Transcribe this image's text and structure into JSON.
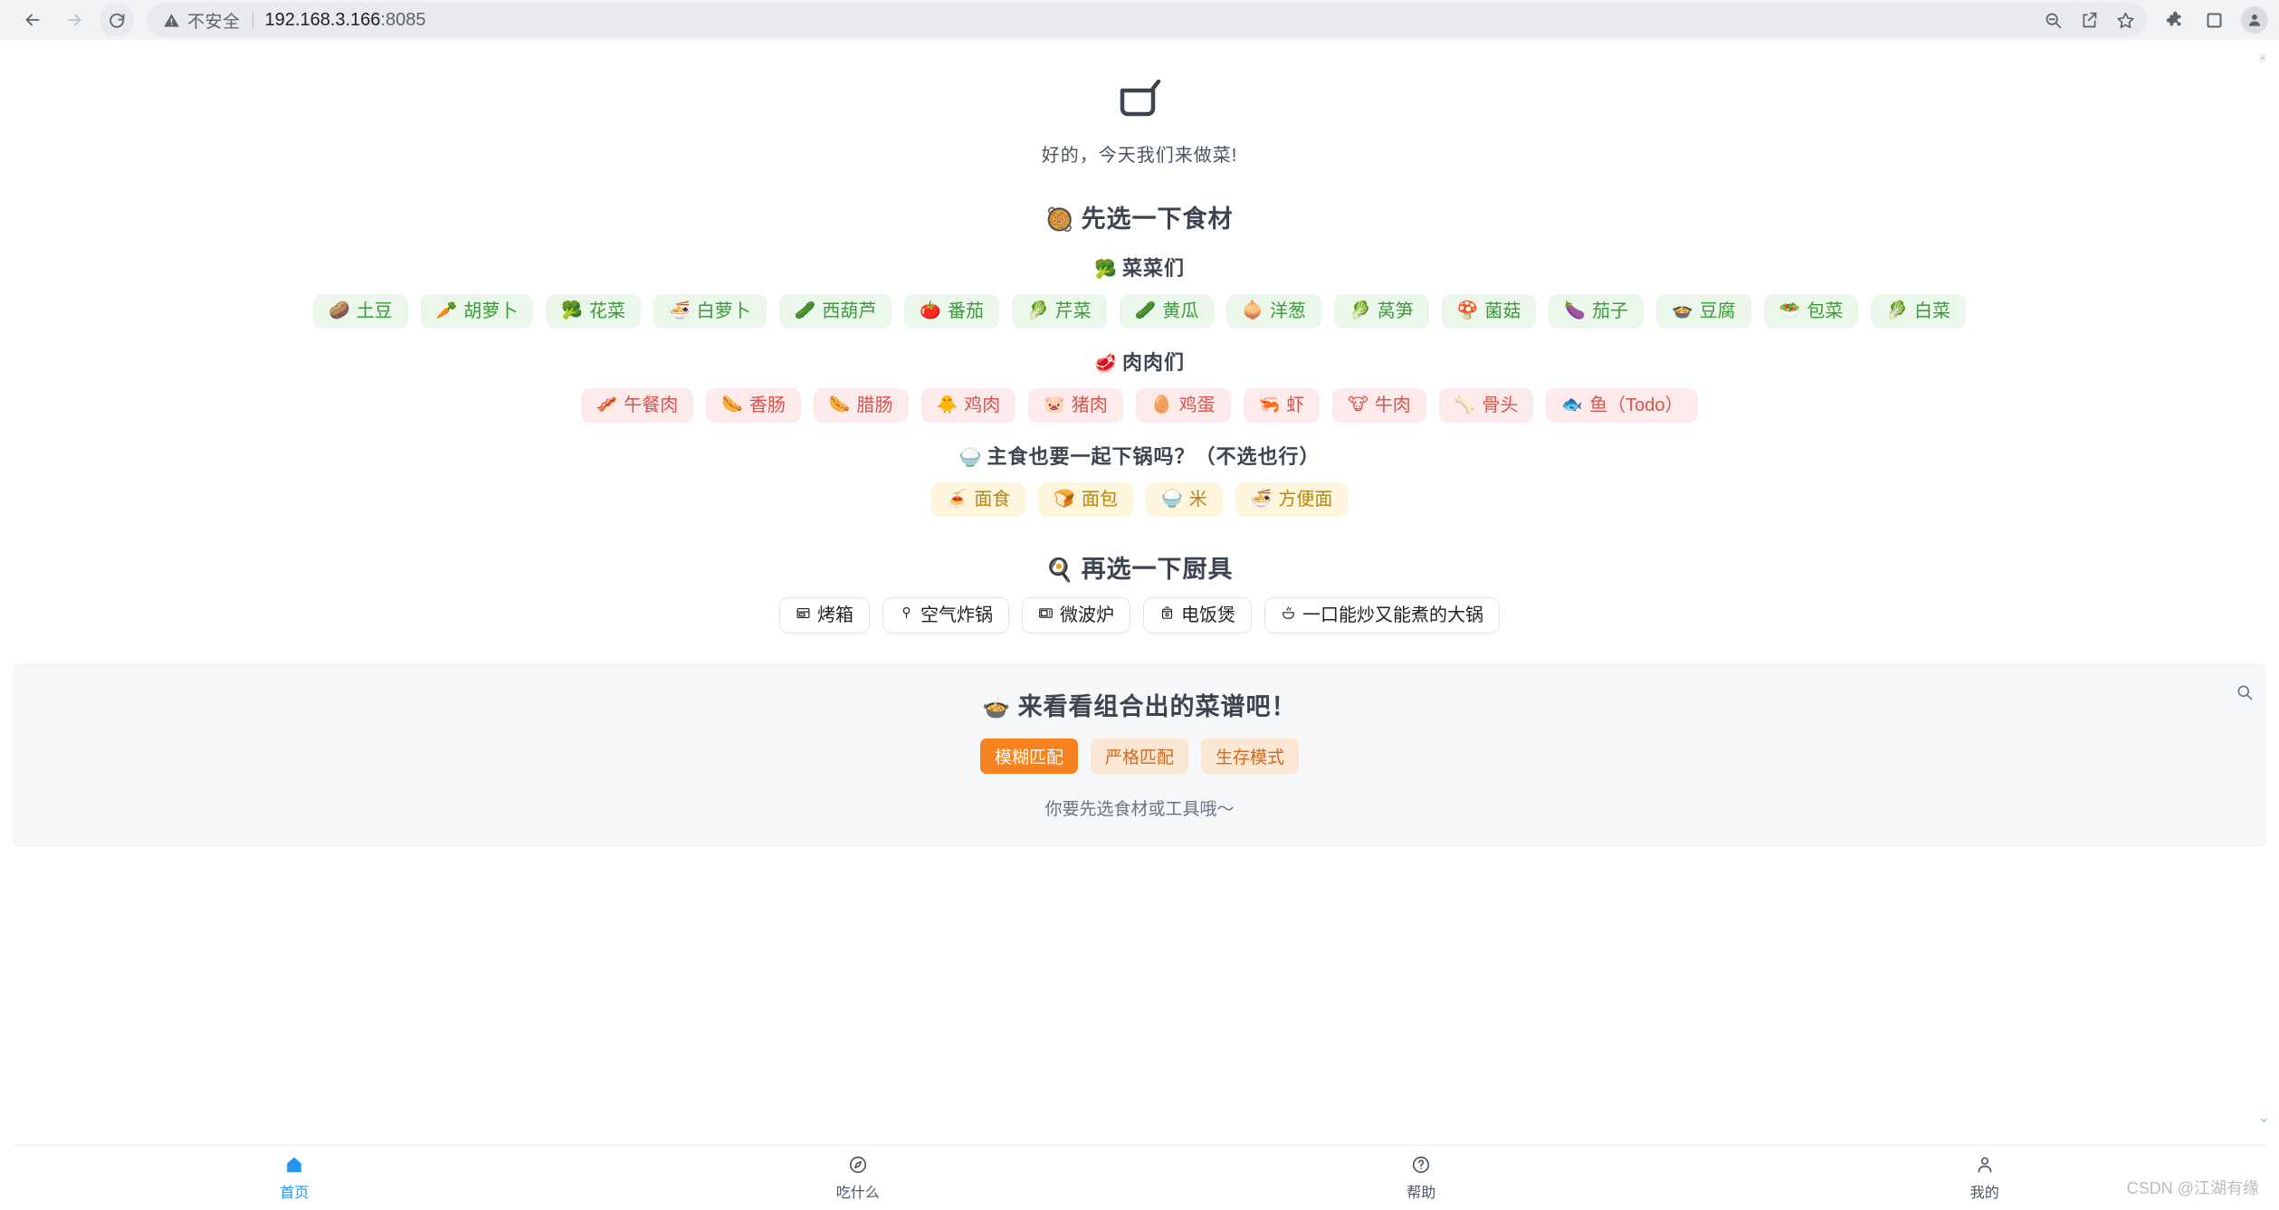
{
  "browser": {
    "back_icon": "back-arrow-icon",
    "forward_icon": "forward-arrow-icon",
    "reload_icon": "reload-icon",
    "security_label": "不安全",
    "url": "192.168.3.166",
    "url_port": ":8085",
    "toolbar_icons": [
      "zoom-out-icon",
      "share-icon",
      "bookmark-star-icon",
      "extensions-icon",
      "side-panel-icon",
      "profile-avatar-icon"
    ]
  },
  "app": {
    "logo_icon": "cooking-pot-icon",
    "tagline": "好的，今天我们来做菜!"
  },
  "ingredients": {
    "title": "先选一下食材",
    "title_emoji": "🥘",
    "veg": {
      "title": "菜菜们",
      "emoji": "🥦",
      "items": [
        {
          "emoji": "🥔",
          "label": "土豆"
        },
        {
          "emoji": "🥕",
          "label": "胡萝卜"
        },
        {
          "emoji": "🥦",
          "label": "花菜"
        },
        {
          "emoji": "🍜",
          "label": "白萝卜"
        },
        {
          "emoji": "🥒",
          "label": "西葫芦"
        },
        {
          "emoji": "🍅",
          "label": "番茄"
        },
        {
          "emoji": "🥬",
          "label": "芹菜"
        },
        {
          "emoji": "🥒",
          "label": "黄瓜"
        },
        {
          "emoji": "🧅",
          "label": "洋葱"
        },
        {
          "emoji": "🥬",
          "label": "莴笋"
        },
        {
          "emoji": "🍄",
          "label": "菌菇"
        },
        {
          "emoji": "🍆",
          "label": "茄子"
        },
        {
          "emoji": "🍲",
          "label": "豆腐"
        },
        {
          "emoji": "🥗",
          "label": "包菜"
        },
        {
          "emoji": "🥬",
          "label": "白菜"
        }
      ]
    },
    "meat": {
      "title": "肉肉们",
      "emoji": "🥩",
      "items": [
        {
          "emoji": "🥓",
          "label": "午餐肉"
        },
        {
          "emoji": "🌭",
          "label": "香肠"
        },
        {
          "emoji": "🌭",
          "label": "腊肠"
        },
        {
          "emoji": "🐥",
          "label": "鸡肉"
        },
        {
          "emoji": "🐷",
          "label": "猪肉"
        },
        {
          "emoji": "🥚",
          "label": "鸡蛋"
        },
        {
          "emoji": "🦐",
          "label": "虾"
        },
        {
          "emoji": "🐮",
          "label": "牛肉"
        },
        {
          "emoji": "🦴",
          "label": "骨头"
        },
        {
          "emoji": "🐟",
          "label": "鱼（Todo）"
        }
      ]
    },
    "staple": {
      "title": "主食也要一起下锅吗？（不选也行）",
      "emoji": "🍚",
      "items": [
        {
          "emoji": "🍝",
          "label": "面食"
        },
        {
          "emoji": "🍞",
          "label": "面包"
        },
        {
          "emoji": "🍚",
          "label": "米"
        },
        {
          "emoji": "🍜",
          "label": "方便面"
        }
      ]
    }
  },
  "tools": {
    "title": "再选一下厨具",
    "emoji": "🍳",
    "items": [
      {
        "icon": "oven-icon",
        "label": "烤箱"
      },
      {
        "icon": "air-fryer-icon",
        "label": "空气炸锅"
      },
      {
        "icon": "microwave-icon",
        "label": "微波炉"
      },
      {
        "icon": "rice-cooker-icon",
        "label": "电饭煲"
      },
      {
        "icon": "wok-icon",
        "label": "一口能炒又能煮的大锅"
      }
    ]
  },
  "results": {
    "title": "来看看组合出的菜谱吧！",
    "emoji": "🍲",
    "tabs": [
      {
        "label": "模糊匹配",
        "active": true
      },
      {
        "label": "严格匹配",
        "active": false
      },
      {
        "label": "生存模式",
        "active": false
      }
    ],
    "hint": "你要先选食材或工具哦～",
    "search_icon": "search-icon",
    "accent_color": "#f5821f"
  },
  "tabbar": {
    "items": [
      {
        "icon": "home-icon",
        "label": "首页",
        "active": true
      },
      {
        "icon": "compass-icon",
        "label": "吃什么",
        "active": false
      },
      {
        "icon": "help-icon",
        "label": "帮助",
        "active": false
      },
      {
        "icon": "person-icon",
        "label": "我的",
        "active": false
      }
    ],
    "active_color": "#2196f3"
  },
  "watermark": "CSDN @江湖有缘"
}
